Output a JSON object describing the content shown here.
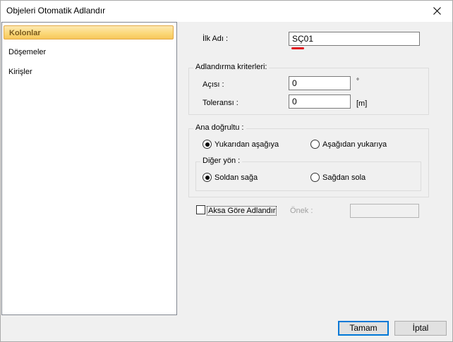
{
  "window": {
    "title": "Objeleri Otomatik Adlandır"
  },
  "sidebar": {
    "items": [
      {
        "label": "Kolonlar",
        "selected": true
      },
      {
        "label": "Döşemeler",
        "selected": false
      },
      {
        "label": "Kirişler",
        "selected": false
      }
    ]
  },
  "form": {
    "first_name_label": "İlk Adı :",
    "first_name_value": "SÇ01",
    "criteria": {
      "title": "Adlandırma kriterleri:",
      "angle_label": "Açısı :",
      "angle_value": "0",
      "angle_unit": "°",
      "tolerance_label": "Toleransı :",
      "tolerance_value": "0",
      "tolerance_unit": "[m]"
    },
    "main_direction": {
      "title": "Ana doğrultu  :",
      "option_top_down": "Yukarıdan aşağıya",
      "option_bottom_up": "Aşağıdan yukarıya",
      "selected": "top_down",
      "other_direction": {
        "title": "Diğer yön :",
        "option_left_right": "Soldan sağa",
        "option_right_left": "Sağdan sola",
        "selected": "left_right"
      }
    },
    "axis_checkbox_label": "Aksa Göre Adlandır",
    "axis_checkbox_checked": false,
    "prefix_label": "Önek :",
    "prefix_value": ""
  },
  "buttons": {
    "ok": "Tamam",
    "cancel": "İptal"
  },
  "icons": {
    "close": "close-icon"
  }
}
